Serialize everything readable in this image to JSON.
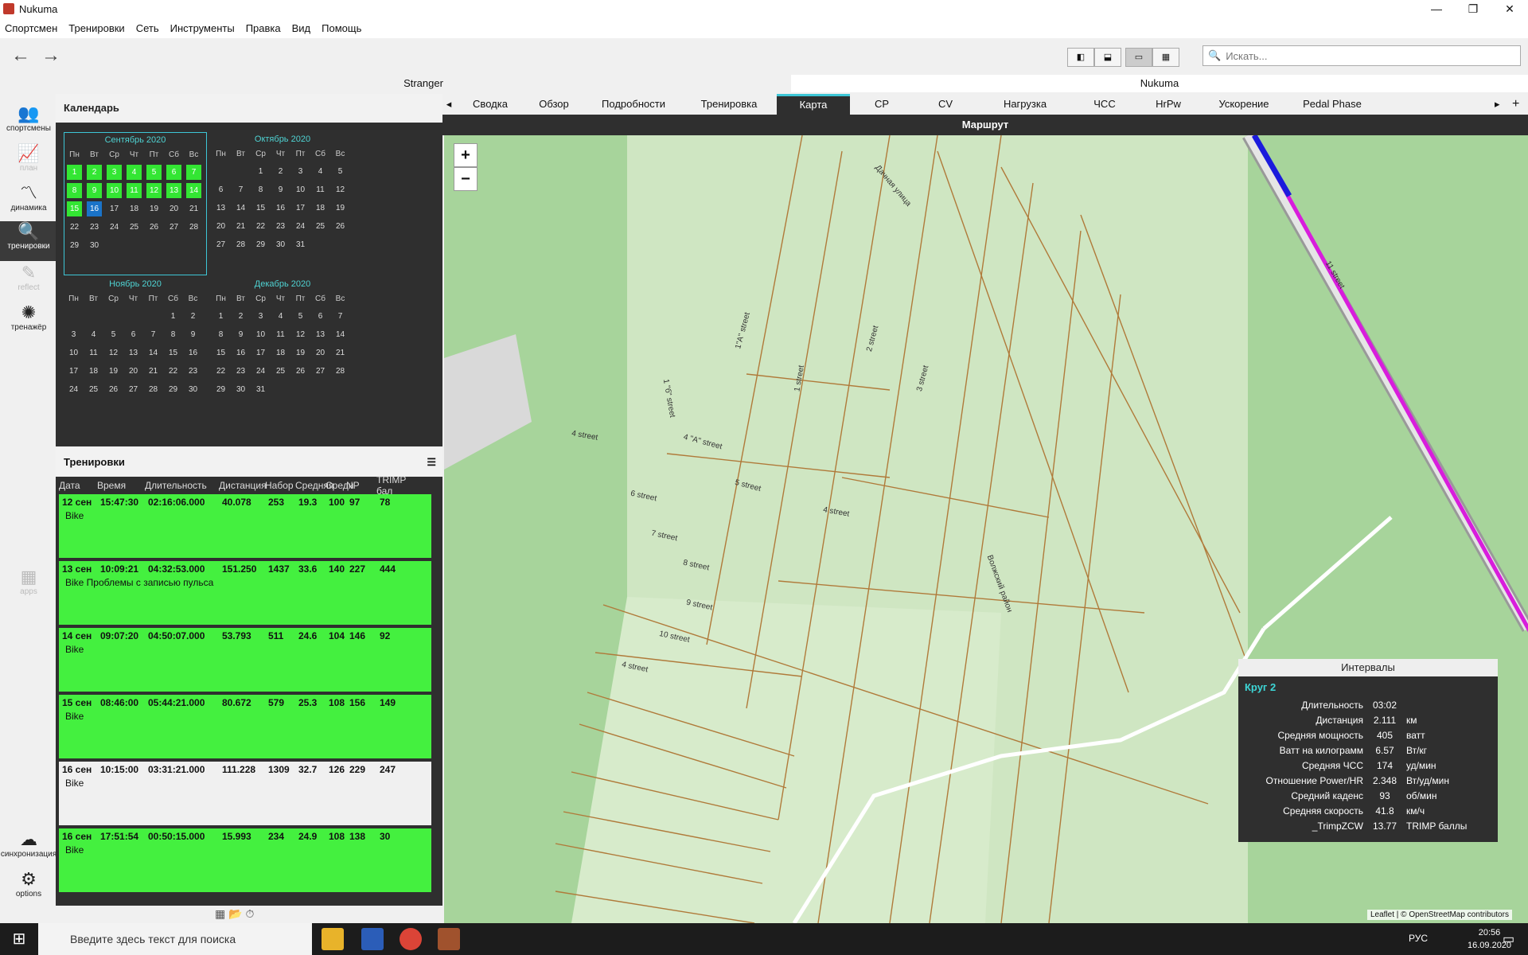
{
  "window": {
    "title": "Nukuma"
  },
  "menu": [
    "Спортсмен",
    "Тренировки",
    "Сеть",
    "Инструменты",
    "Правка",
    "Вид",
    "Помощь"
  ],
  "search": {
    "placeholder": "Искать..."
  },
  "athletes": [
    "Stranger",
    "Nukuma"
  ],
  "nav": [
    {
      "label": "спортсмены",
      "icon": "people-icon"
    },
    {
      "label": "план",
      "icon": "plan-icon"
    },
    {
      "label": "динамика",
      "icon": "trend-icon"
    },
    {
      "label": "тренировки",
      "icon": "search-icon"
    },
    {
      "label": "reflect",
      "icon": "reflect-icon"
    },
    {
      "label": "тренажёр",
      "icon": "fan-icon"
    },
    {
      "label": "apps",
      "icon": "apps-icon"
    },
    {
      "label": "синхронизация",
      "icon": "cloud-icon"
    },
    {
      "label": "options",
      "icon": "gear-icon"
    }
  ],
  "calendar": {
    "title": "Календарь",
    "dow": [
      "Пн",
      "Вт",
      "Ср",
      "Чт",
      "Пт",
      "Сб",
      "Вс"
    ],
    "months": [
      {
        "name": "Сентябрь 2020",
        "offset": 1,
        "days": 30,
        "green": [
          1,
          2,
          3,
          4,
          5,
          6,
          7,
          8,
          9,
          10,
          11,
          12,
          13,
          14,
          15
        ],
        "today": 16
      },
      {
        "name": "Октябрь 2020",
        "offset": 3,
        "days": 31,
        "green": [],
        "today": 0
      },
      {
        "name": "Ноябрь 2020",
        "offset": 6,
        "days": 30,
        "green": [],
        "today": 0
      },
      {
        "name": "Декабрь 2020",
        "offset": 1,
        "days": 31,
        "green": [],
        "today": 0
      }
    ]
  },
  "rides": {
    "title": "Тренировки",
    "columns": [
      "Дата",
      "Время",
      "Длительность",
      "Дистанция",
      "Набор",
      "Средняя",
      "Средн",
      "NP",
      "TRIMP бал"
    ],
    "rows": [
      {
        "date": "12 сен",
        "time": "15:47:30",
        "dur": "02:16:06.000",
        "dist": "40.078",
        "gain": "253",
        "avg": "19.3",
        "hr": "100",
        "np": "97",
        "trimp": "78",
        "sport": "Bike",
        "sel": false
      },
      {
        "date": "13 сен",
        "time": "10:09:21",
        "dur": "04:32:53.000",
        "dist": "151.250",
        "gain": "1437",
        "avg": "33.6",
        "hr": "140",
        "np": "227",
        "trimp": "444",
        "sport": "Bike Проблемы с записью пульса",
        "sel": false
      },
      {
        "date": "14 сен",
        "time": "09:07:20",
        "dur": "04:50:07.000",
        "dist": "53.793",
        "gain": "511",
        "avg": "24.6",
        "hr": "104",
        "np": "146",
        "trimp": "92",
        "sport": "Bike",
        "sel": false
      },
      {
        "date": "15 сен",
        "time": "08:46:00",
        "dur": "05:44:21.000",
        "dist": "80.672",
        "gain": "579",
        "avg": "25.3",
        "hr": "108",
        "np": "156",
        "trimp": "149",
        "sport": "Bike",
        "sel": false
      },
      {
        "date": "16 сен",
        "time": "10:15:00",
        "dur": "03:31:21.000",
        "dist": "111.228",
        "gain": "1309",
        "avg": "32.7",
        "hr": "126",
        "np": "229",
        "trimp": "247",
        "sport": "Bike",
        "sel": true
      },
      {
        "date": "16 сен",
        "time": "17:51:54",
        "dur": "00:50:15.000",
        "dist": "15.993",
        "gain": "234",
        "avg": "24.9",
        "hr": "108",
        "np": "138",
        "trimp": "30",
        "sport": "Bike",
        "sel": false
      }
    ]
  },
  "tabs": [
    "Сводка",
    "Обзор",
    "Подробности",
    "Тренировка",
    "Карта",
    "CP",
    "CV",
    "Нагрузка",
    "ЧСС",
    "HrPw",
    "Ускорение",
    "Pedal Phase"
  ],
  "active_tab": "Карта",
  "route_title": "Маршрут",
  "map": {
    "zoom_in": "+",
    "zoom_out": "−",
    "attribution": "Leaflet | © OpenStreetMap contributors",
    "labels": [
      "Дачная улица",
      "1\"А\" street",
      "1 street",
      "2 street",
      "3 street",
      "4 street",
      "4 \"А\" street",
      "1 \"б\" street",
      "5 street",
      "6 street",
      "7 street",
      "8 street",
      "9 street",
      "10 street",
      "4 street",
      "4 street",
      "Волжский район",
      "11 street"
    ]
  },
  "intervals": {
    "title": "Интервалы",
    "name": "Круг 2",
    "rows": [
      {
        "k": "Длительность",
        "v": "03:02",
        "u": ""
      },
      {
        "k": "Дистанция",
        "v": "2.111",
        "u": "км"
      },
      {
        "k": "Средняя мощность",
        "v": "405",
        "u": "ватт"
      },
      {
        "k": "Ватт на килограмм",
        "v": "6.57",
        "u": "Вт/кг"
      },
      {
        "k": "Средняя ЧСС",
        "v": "174",
        "u": "уд/мин"
      },
      {
        "k": "Отношение Power/HR",
        "v": "2.348",
        "u": "Вт/уд/мин"
      },
      {
        "k": "Средний каденс",
        "v": "93",
        "u": "об/мин"
      },
      {
        "k": "Средняя скорость",
        "v": "41.8",
        "u": "км/ч"
      },
      {
        "k": "_TrimpZCW",
        "v": "13.77",
        "u": "TRIMP баллы"
      }
    ]
  },
  "taskbar": {
    "search_placeholder": "Введите здесь текст для поиска",
    "lang": "РУС",
    "time": "20:56",
    "date": "16.09.2020"
  }
}
